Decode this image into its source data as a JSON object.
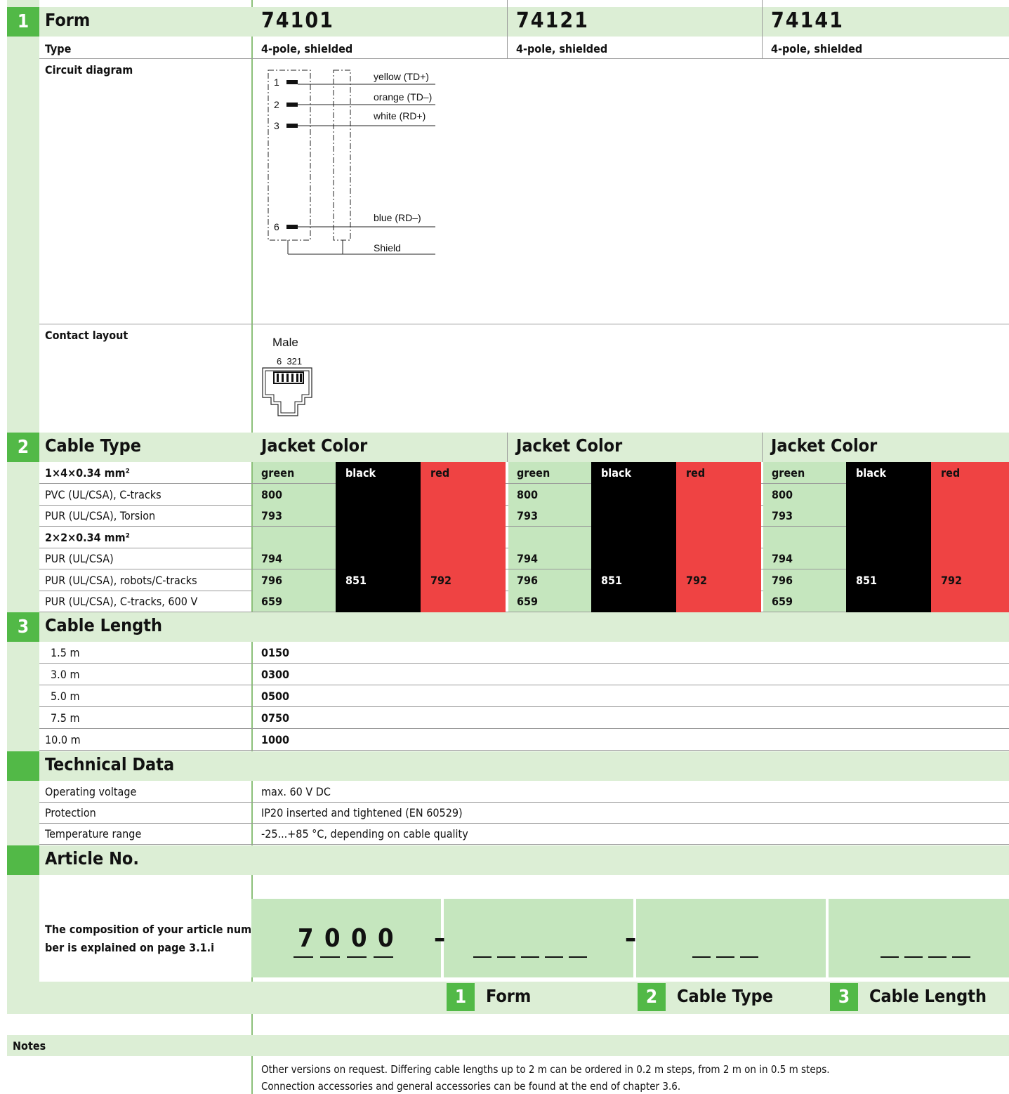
{
  "section1": {
    "num": "1",
    "label": "Form",
    "forms": [
      "74101",
      "74121",
      "74141"
    ],
    "type_label": "Type",
    "type_value": "4-pole, shielded",
    "circuit_label": "Circuit diagram",
    "circuit": {
      "pins": [
        "1",
        "2",
        "3",
        "6"
      ],
      "wires": [
        "yellow (TD+)",
        "orange (TD–)",
        "white (RD+)",
        "blue (RD–)"
      ],
      "shield": "Shield"
    },
    "contact_label": "Contact layout",
    "contact": {
      "gender": "Male",
      "pins": "6  321"
    }
  },
  "section2": {
    "num": "2",
    "label": "Cable Type",
    "jacket_label": "Jacket Color",
    "colors": [
      "green",
      "black",
      "red"
    ],
    "rows": [
      {
        "label": "1×4×0.34 mm²",
        "bold": true,
        "header": true,
        "vals": [
          "green",
          "black",
          "red"
        ]
      },
      {
        "label": "PVC (UL/CSA), C-tracks",
        "vals": [
          "800",
          "",
          ""
        ]
      },
      {
        "label": "PUR (UL/CSA), Torsion",
        "vals": [
          "793",
          "",
          ""
        ]
      },
      {
        "label": "2×2×0.34 mm²",
        "bold": true,
        "vals": [
          "",
          "",
          ""
        ]
      },
      {
        "label": "PUR (UL/CSA)",
        "vals": [
          "794",
          "",
          ""
        ]
      },
      {
        "label": "PUR (UL/CSA), robots/C-tracks",
        "vals": [
          "796",
          "851",
          "792"
        ]
      },
      {
        "label": "PUR (UL/CSA), C-tracks, 600 V",
        "vals": [
          "659",
          "",
          ""
        ]
      }
    ]
  },
  "section3": {
    "num": "3",
    "label": "Cable Length",
    "rows": [
      {
        "len": "1.5 m",
        "code": "0150"
      },
      {
        "len": "3.0 m",
        "code": "0300"
      },
      {
        "len": "5.0 m",
        "code": "0500"
      },
      {
        "len": "7.5 m",
        "code": "0750"
      },
      {
        "len": "10.0 m",
        "code": "1000"
      }
    ]
  },
  "technical": {
    "label": "Technical Data",
    "rows": [
      {
        "k": "Operating voltage",
        "v": "max. 60 V DC"
      },
      {
        "k": "Protection",
        "v": "IP20 inserted and tightened (EN 60529)"
      },
      {
        "k": "Temperature range",
        "v": "-25...+85 °C, depending on cable quality"
      }
    ]
  },
  "article": {
    "label": "Article No.",
    "note": "The composition of your article num-ber is explained on page 3.1.i",
    "note_line1": "The composition of your article num-",
    "note_line2": "ber is explained on page 3.1.i",
    "prefix_digits": [
      "7",
      "0",
      "0",
      "0"
    ],
    "dash": "–",
    "legend": [
      {
        "num": "1",
        "label": "Form"
      },
      {
        "num": "2",
        "label": "Cable Type"
      },
      {
        "num": "3",
        "label": "Cable Length"
      }
    ]
  },
  "notes": {
    "label": "Notes",
    "lines": [
      "Other versions on request. Differing cable lengths up to 2 m can be ordered in 0.2 m steps, from 2 m on in 0.5 m steps.",
      "Connection accessories and general accessories can be found at the end of chapter 3.6."
    ]
  }
}
